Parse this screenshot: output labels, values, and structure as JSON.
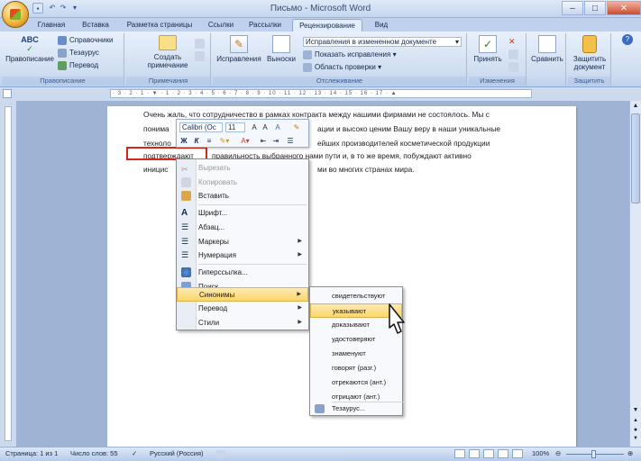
{
  "window": {
    "title": "Письмо - Microsoft Word"
  },
  "tabs": [
    "Главная",
    "Вставка",
    "Разметка страницы",
    "Ссылки",
    "Рассылки",
    "Рецензирование",
    "Вид"
  ],
  "active_tab": "Рецензирование",
  "ribbon": {
    "proofing": {
      "label": "Правописание",
      "big": "Правописание",
      "items": [
        "Справочники",
        "Тезаурус",
        "Перевод"
      ]
    },
    "comments": {
      "label": "Примечания",
      "create": "Создать примечание"
    },
    "tracking": {
      "label": "Отслеживание",
      "track": "Исправления",
      "balloons": "Выноски",
      "combo1": "Исправления в измененном документе",
      "show": "Показать исправления",
      "pane": "Область проверки"
    },
    "changes": {
      "label": "Изменения",
      "accept": "Принять"
    },
    "compare": {
      "label": "Сравнить"
    },
    "protect": {
      "label": "Защитить",
      "button": "Защитить документ"
    }
  },
  "document": {
    "lines": [
      "Очень жаль, что сотрудничество в рамках контракта между нашими фирмами не состоялось. Мы с",
      "понима",
      "техноло",
      "подтверждают",
      "иницис"
    ],
    "line_tails": [
      "",
      "ации и высоко ценим Вашу веру в наши уникальные",
      "ейших производителей косметической продукции",
      "правильность выбранного нами пути и, в то же время, побуждают активно",
      "ми во многих странах мира."
    ]
  },
  "mini_toolbar": {
    "font": "Calibri (Ос",
    "size": "11",
    "bold": "Ж",
    "italic": "К"
  },
  "context_menu": [
    {
      "label": "Вырезать",
      "disabled": true,
      "icon": "scissors-icon"
    },
    {
      "label": "Копировать",
      "disabled": true,
      "icon": "copy-icon"
    },
    {
      "label": "Вставить",
      "disabled": false,
      "icon": "paste-icon"
    },
    {
      "label": "Шрифт...",
      "disabled": false,
      "icon": "font-icon"
    },
    {
      "label": "Абзац...",
      "disabled": false,
      "icon": "paragraph-icon"
    },
    {
      "label": "Маркеры",
      "disabled": false,
      "icon": "bullets-icon",
      "submenu": true
    },
    {
      "label": "Нумерация",
      "disabled": false,
      "icon": "numbering-icon",
      "submenu": true
    },
    {
      "label": "Гиперссылка...",
      "disabled": false,
      "icon": "hyperlink-icon"
    },
    {
      "label": "Поиск...",
      "disabled": false,
      "icon": "search-icon"
    },
    {
      "label": "Синонимы",
      "disabled": false,
      "submenu": true,
      "active": true
    },
    {
      "label": "Перевод",
      "disabled": false,
      "submenu": true
    },
    {
      "label": "Стили",
      "disabled": false,
      "submenu": true
    }
  ],
  "synonyms_submenu": [
    "свидетельствуют",
    "указывают",
    "доказывают",
    "удостоверяют",
    "знаменуют",
    "говорят (разг.)",
    "отрекаются (ант.)",
    "отрицают (ант.)",
    "Тезаурус..."
  ],
  "synonyms_active": "указывают",
  "status": {
    "page": "Страница: 1 из 1",
    "words": "Число слов: 55",
    "lang": "Русский (Россия)",
    "zoom": "100%"
  },
  "colors": {
    "highlight": "#d3251a",
    "menu_hover": "#fbd66a"
  }
}
